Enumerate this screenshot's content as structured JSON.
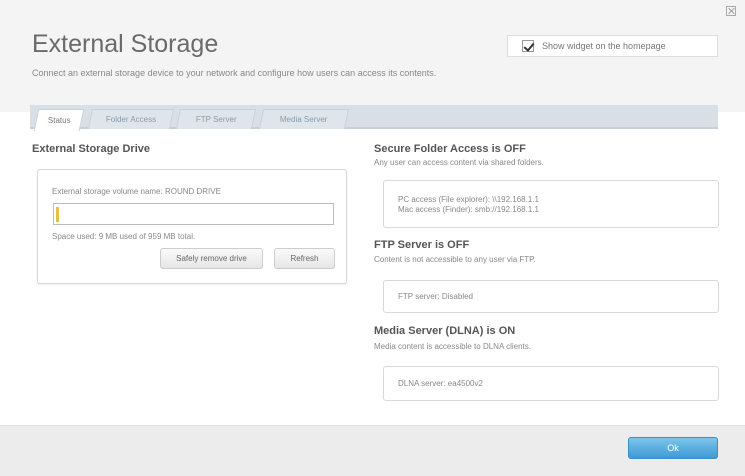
{
  "header": {
    "title": "External Storage",
    "subtitle": "Connect an external storage device to your network and configure how users can access its contents.",
    "widget_label": "Show widget on the homepage",
    "widget_checked": true
  },
  "tabs": [
    {
      "label": "Status",
      "active": true
    },
    {
      "label": "Folder Access",
      "active": false
    },
    {
      "label": "FTP Server",
      "active": false
    },
    {
      "label": "Media Server",
      "active": false
    }
  ],
  "drive": {
    "heading": "External Storage Drive",
    "volume_line": "External storage volume name: ROUND DRIVE",
    "volume_input_value": "",
    "space_line": "Space used: 9 MB used of 959 MB total.",
    "remove_button": "Safely remove drive",
    "refresh_button": "Refresh"
  },
  "secure_folder": {
    "heading": "Secure Folder Access is OFF",
    "desc": "Any user can access content via shared folders.",
    "pc_access": "PC access (File explorer): \\\\192.168.1.1",
    "mac_access": "Mac access (Finder): smb://192.168.1.1"
  },
  "ftp": {
    "heading": "FTP Server is OFF",
    "desc": "Content is not accessible to any user via FTP.",
    "status": "FTP server: Disabled"
  },
  "media": {
    "heading": "Media Server (DLNA) is ON",
    "desc": "Media content is accessible to DLNA clients.",
    "status": "DLNA server: ea4500v2"
  },
  "footer": {
    "ok_label": "Ok"
  },
  "colors": {
    "accent": "#4aa3d9",
    "tabbar": "#d8e0e6"
  }
}
